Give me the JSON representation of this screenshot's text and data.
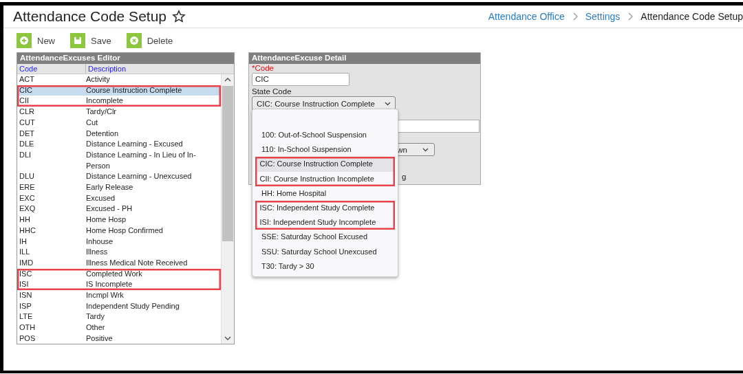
{
  "page": {
    "title": "Attendance Code Setup",
    "favorite": false
  },
  "breadcrumb": [
    {
      "label": "Attendance Office",
      "kind": "link"
    },
    {
      "label": "Settings",
      "kind": "link"
    },
    {
      "label": "Attendance Code Setup",
      "kind": "current"
    }
  ],
  "toolbar": [
    {
      "label": "New",
      "kind": "new"
    },
    {
      "label": "Save",
      "kind": "save"
    },
    {
      "label": "Delete",
      "kind": "delete"
    }
  ],
  "editor": {
    "title": "AttendanceExcuses Editor",
    "columns": [
      "Code",
      "Description"
    ],
    "rows": [
      {
        "code": "ACT",
        "description": "Activity",
        "selected": false,
        "highlighted": false
      },
      {
        "code": "CIC",
        "description": "Course Instruction Complete",
        "selected": true,
        "highlighted": true
      },
      {
        "code": "CII",
        "description": "Incomplete",
        "selected": false,
        "highlighted": true
      },
      {
        "code": "CLR",
        "description": "Tardy/Clr",
        "selected": false,
        "highlighted": false
      },
      {
        "code": "CUT",
        "description": "Cut",
        "selected": false,
        "highlighted": false
      },
      {
        "code": "DET",
        "description": "Detention",
        "selected": false,
        "highlighted": false
      },
      {
        "code": "DLE",
        "description": "Distance Learning - Excused",
        "selected": false,
        "highlighted": false
      },
      {
        "code": "DLI",
        "description": "Distance Learning - In Lieu of In-Person",
        "selected": false,
        "highlighted": false
      },
      {
        "code": "DLU",
        "description": "Distance Learning - Unexcused",
        "selected": false,
        "highlighted": false
      },
      {
        "code": "ERE",
        "description": "Early Release",
        "selected": false,
        "highlighted": false
      },
      {
        "code": "EXC",
        "description": "Excused",
        "selected": false,
        "highlighted": false
      },
      {
        "code": "EXQ",
        "description": "Excused - PH",
        "selected": false,
        "highlighted": false
      },
      {
        "code": "HH",
        "description": "Home Hosp",
        "selected": false,
        "highlighted": false
      },
      {
        "code": "HHC",
        "description": "Home Hosp Confirmed",
        "selected": false,
        "highlighted": false
      },
      {
        "code": "IH",
        "description": "Inhouse",
        "selected": false,
        "highlighted": false
      },
      {
        "code": "ILL",
        "description": "Illness",
        "selected": false,
        "highlighted": false
      },
      {
        "code": "IMD",
        "description": "Illness Medical Note Received",
        "selected": false,
        "highlighted": false
      },
      {
        "code": "ISC",
        "description": "Completed Work",
        "selected": false,
        "highlighted": true
      },
      {
        "code": "ISI",
        "description": "IS Incomplete",
        "selected": false,
        "highlighted": true
      },
      {
        "code": "ISN",
        "description": "Incmpl Wrk",
        "selected": false,
        "highlighted": false
      },
      {
        "code": "ISP",
        "description": "Independent Study Pending",
        "selected": false,
        "highlighted": false
      },
      {
        "code": "LTE",
        "description": "Tardy",
        "selected": false,
        "highlighted": false
      },
      {
        "code": "OTH",
        "description": "Other",
        "selected": false,
        "highlighted": false
      },
      {
        "code": "POS",
        "description": "Positive",
        "selected": false,
        "highlighted": false
      }
    ]
  },
  "detail": {
    "title": "AttendanceExcuse Detail",
    "code_label": "*Code",
    "code_value": "CIC",
    "state_code_label": "State Code",
    "state_code_value": "CIC: Course Instruction Complete",
    "partial_select_text": "wn",
    "partial_label_text": "g",
    "dropdown": {
      "open": true,
      "options": [
        {
          "label": "100: Out-of-School Suspension",
          "selected": false,
          "highlighted": false
        },
        {
          "label": "110: In-School Suspension",
          "selected": false,
          "highlighted": false
        },
        {
          "label": "CIC: Course Instruction Complete",
          "selected": true,
          "highlighted": true
        },
        {
          "label": "CII: Course Instruction Incomplete",
          "selected": false,
          "highlighted": true
        },
        {
          "label": "HH: Home Hospital",
          "selected": false,
          "highlighted": false
        },
        {
          "label": "ISC: Independent Study Complete",
          "selected": false,
          "highlighted": true
        },
        {
          "label": "ISI: Independent Study Incomplete",
          "selected": false,
          "highlighted": true
        },
        {
          "label": "SSE: Saturday School Excused",
          "selected": false,
          "highlighted": false
        },
        {
          "label": "SSU: Saturday School Unexcused",
          "selected": false,
          "highlighted": false
        },
        {
          "label": "T30: Tardy > 30",
          "selected": false,
          "highlighted": false
        }
      ]
    }
  }
}
